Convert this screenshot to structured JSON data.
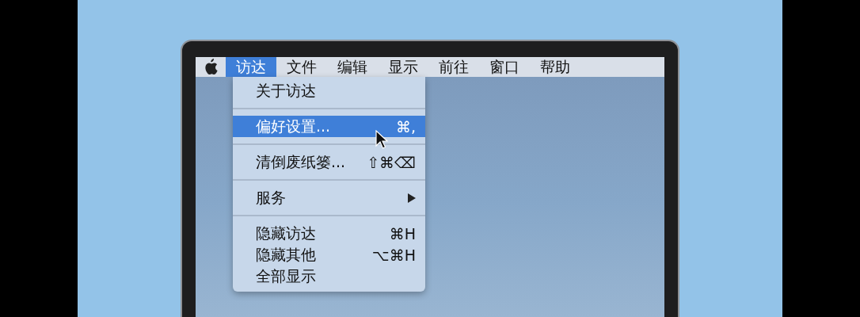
{
  "menu_bar": {
    "items": [
      {
        "label": "访达",
        "selected": true
      },
      {
        "label": "文件",
        "selected": false
      },
      {
        "label": "编辑",
        "selected": false
      },
      {
        "label": "显示",
        "selected": false
      },
      {
        "label": "前往",
        "selected": false
      },
      {
        "label": "窗口",
        "selected": false
      },
      {
        "label": "帮助",
        "selected": false
      }
    ]
  },
  "menu": {
    "items": [
      {
        "kind": "item",
        "label": "关于访达",
        "selected": false
      },
      {
        "kind": "separator"
      },
      {
        "kind": "item",
        "label": "偏好设置...",
        "shortcut": "⌘,",
        "selected": true
      },
      {
        "kind": "separator"
      },
      {
        "kind": "item",
        "label": "清倒废纸篓...",
        "shortcut": "⇧⌘⌫",
        "selected": false
      },
      {
        "kind": "separator"
      },
      {
        "kind": "submenu",
        "label": "服务",
        "selected": false
      },
      {
        "kind": "separator"
      },
      {
        "kind": "item",
        "label": "隐藏访达",
        "shortcut": "⌘H",
        "selected": false
      },
      {
        "kind": "item",
        "label": "隐藏其他",
        "shortcut": "⌥⌘H",
        "selected": false
      },
      {
        "kind": "item",
        "label": "全部显示",
        "selected": false
      }
    ]
  }
}
